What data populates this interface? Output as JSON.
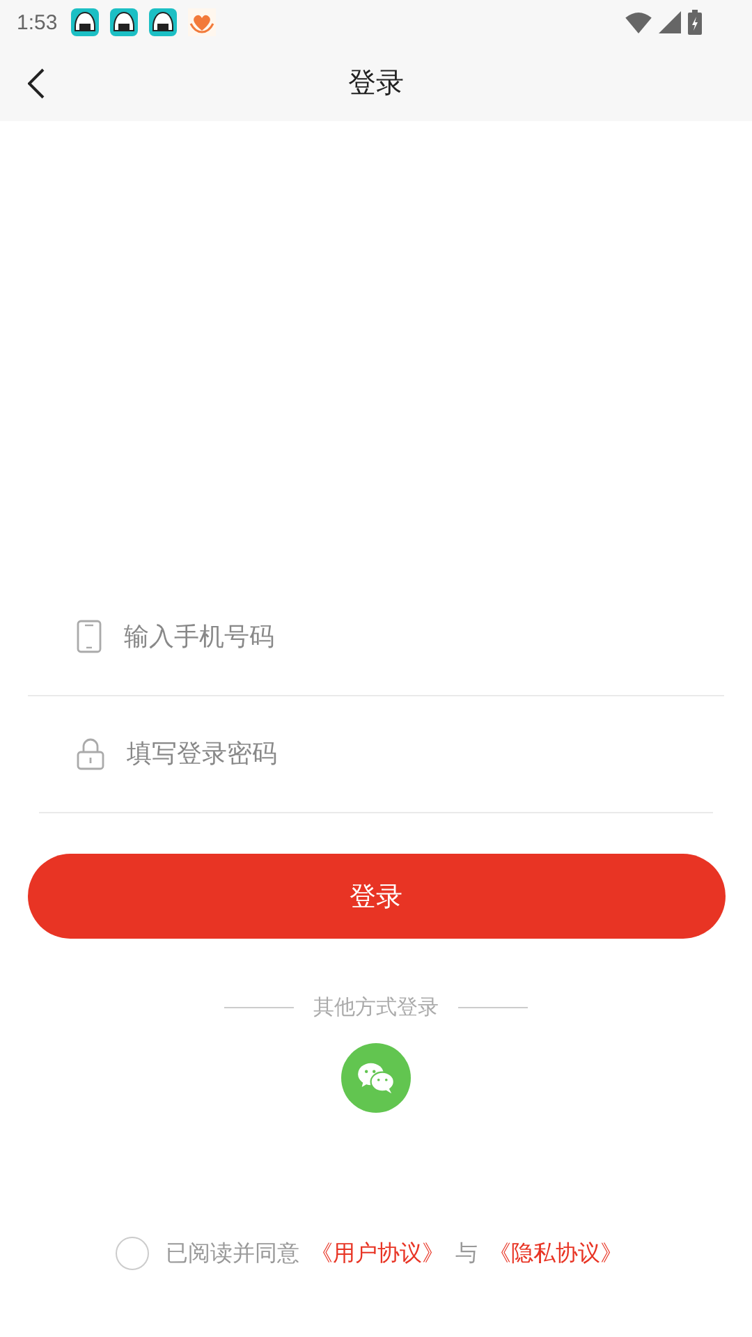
{
  "status_bar": {
    "time": "1:53",
    "notification_icons": [
      {
        "kind": "app"
      },
      {
        "kind": "app"
      },
      {
        "kind": "app"
      },
      {
        "kind": "charity"
      }
    ]
  },
  "header": {
    "title": "登录"
  },
  "form": {
    "phone": {
      "placeholder": "输入手机号码"
    },
    "password": {
      "placeholder": "填写登录密码"
    },
    "submit": "登录"
  },
  "other_login": {
    "label": "其他方式登录"
  },
  "agreement": {
    "checked": false,
    "text": "已阅读并同意",
    "links": [
      "《用户协议》",
      "《隐私协议》"
    ],
    "joiner": "与"
  }
}
